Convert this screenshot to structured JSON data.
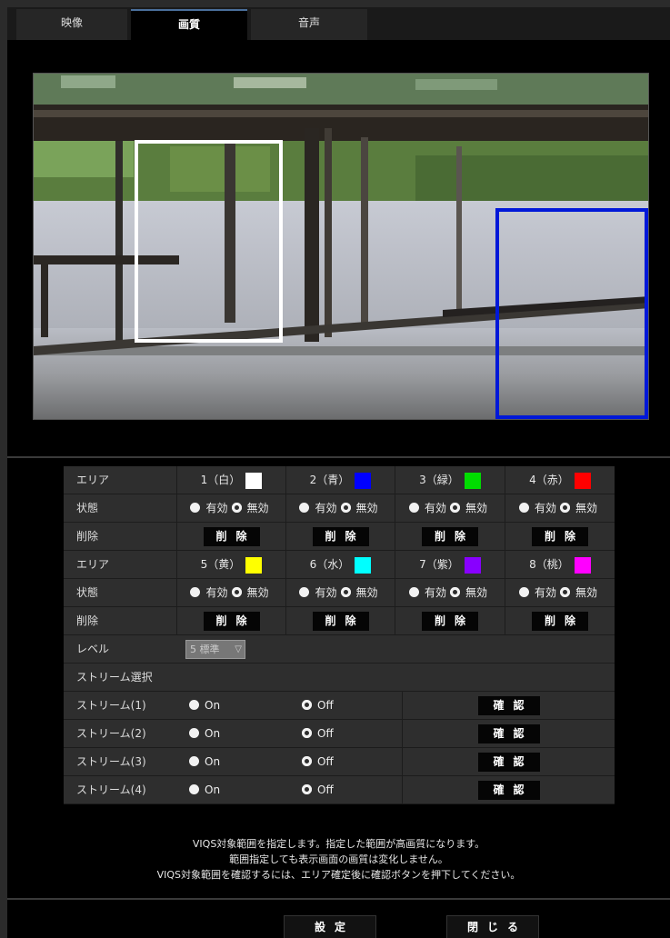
{
  "tabs": [
    "映像",
    "画質",
    "音声"
  ],
  "areas_row1": {
    "label": "エリア",
    "items": [
      {
        "label": "1（白）",
        "color": "#ffffff"
      },
      {
        "label": "2（青）",
        "color": "#0000ff"
      },
      {
        "label": "3（緑）",
        "color": "#00dd00"
      },
      {
        "label": "4（赤）",
        "color": "#ff0000"
      }
    ]
  },
  "areas_row2": {
    "label": "エリア",
    "items": [
      {
        "label": "5（黄）",
        "color": "#ffff00"
      },
      {
        "label": "6（水）",
        "color": "#00ffff"
      },
      {
        "label": "7（紫）",
        "color": "#8800ff"
      },
      {
        "label": "8（桃）",
        "color": "#ff00ff"
      }
    ]
  },
  "status_label": "状態",
  "enable_label": "有効",
  "disable_label": "無効",
  "delete_row_label": "削除",
  "delete_button": "削除",
  "level_label": "レベル",
  "level_value": "5 標準",
  "stream_section_label": "ストリーム選択",
  "streams": [
    {
      "label": "ストリーム(1)",
      "on": "On",
      "off": "Off",
      "selected": "off"
    },
    {
      "label": "ストリーム(2)",
      "on": "On",
      "off": "Off",
      "selected": "off"
    },
    {
      "label": "ストリーム(3)",
      "on": "On",
      "off": "Off",
      "selected": "off"
    },
    {
      "label": "ストリーム(4)",
      "on": "On",
      "off": "Off",
      "selected": "off"
    }
  ],
  "confirm_button": "確認",
  "notes": [
    "VIQS対象範囲を指定します。指定した範囲が高画質になります。",
    "範囲指定しても表示画面の画質は変化しません。",
    "VIQS対象範囲を確認するには、エリア確定後に確認ボタンを押下してください。"
  ],
  "set_button": "設定",
  "close_button": "閉じる",
  "colors": {
    "accent_tab": "#4a6f9c",
    "roi_white": "#ffffff",
    "roi_blue": "#0018d8"
  }
}
